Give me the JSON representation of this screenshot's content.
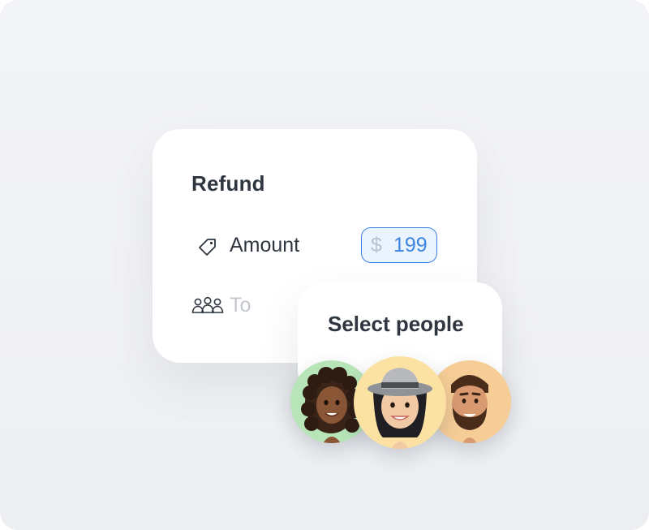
{
  "card": {
    "title": "Refund",
    "amount_label": "Amount",
    "currency_symbol": "$",
    "amount_value": "199",
    "to_label": "To"
  },
  "popup": {
    "title": "Select people",
    "avatars": [
      {
        "name": "avatar-curly-hair",
        "background": "#b7e5b8"
      },
      {
        "name": "avatar-hat",
        "background": "#fbe2a2"
      },
      {
        "name": "avatar-beard",
        "background": "#f6cd96"
      }
    ]
  },
  "colors": {
    "accent": "#3b84e0",
    "text_primary": "#2f3640",
    "text_muted": "#c3c8cf"
  },
  "icons": [
    "tag-icon",
    "people-icon"
  ]
}
